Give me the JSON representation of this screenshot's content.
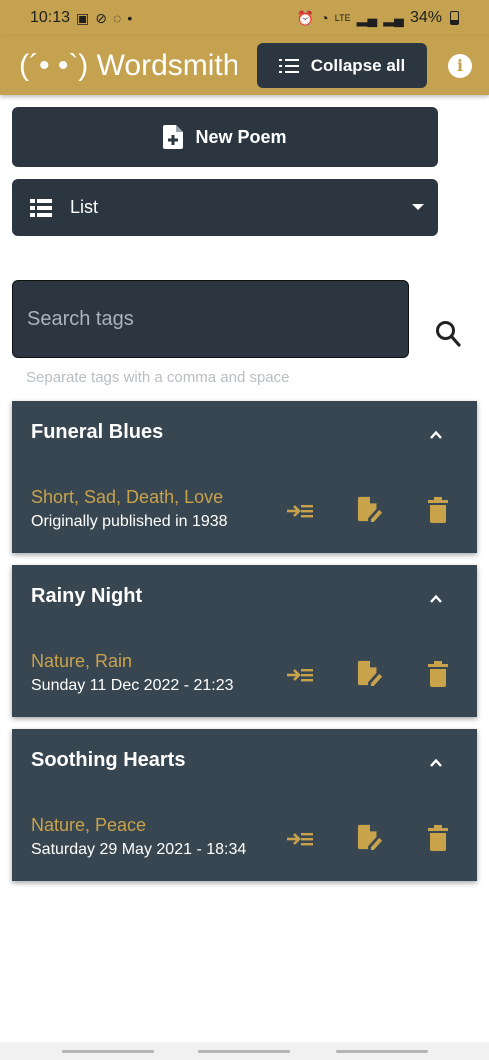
{
  "status_bar": {
    "time": "10:13",
    "battery": "34%",
    "left_icons": [
      "gallery-icon",
      "blocked-icon",
      "whatsapp-icon"
    ],
    "right_icons": [
      "alarm-icon",
      "wifi-icon",
      "lte-icon",
      "signal-icon",
      "signal-icon"
    ]
  },
  "app_bar": {
    "title": "(´• •`) Wordsmith",
    "collapse_label": "Collapse all",
    "info_glyph": "i"
  },
  "new_poem_label": "New Poem",
  "view_select": {
    "selected": "List"
  },
  "search": {
    "placeholder": "Search tags",
    "helper": "Separate tags with a comma and space"
  },
  "poems": [
    {
      "title": "Funeral Blues",
      "tags": "Short, Sad, Death, Love",
      "date": "Originally published in 1938"
    },
    {
      "title": "Rainy Night",
      "tags": "Nature, Rain",
      "date": "Sunday 11 Dec 2022 - 21:23"
    },
    {
      "title": "Soothing Hearts",
      "tags": "Nature, Peace",
      "date": "Saturday 29 May 2021 - 18:34"
    }
  ],
  "colors": {
    "accent": "#c4a24f",
    "dark": "#2b3640",
    "card": "#374650",
    "tag_text": "#c9a24c"
  }
}
